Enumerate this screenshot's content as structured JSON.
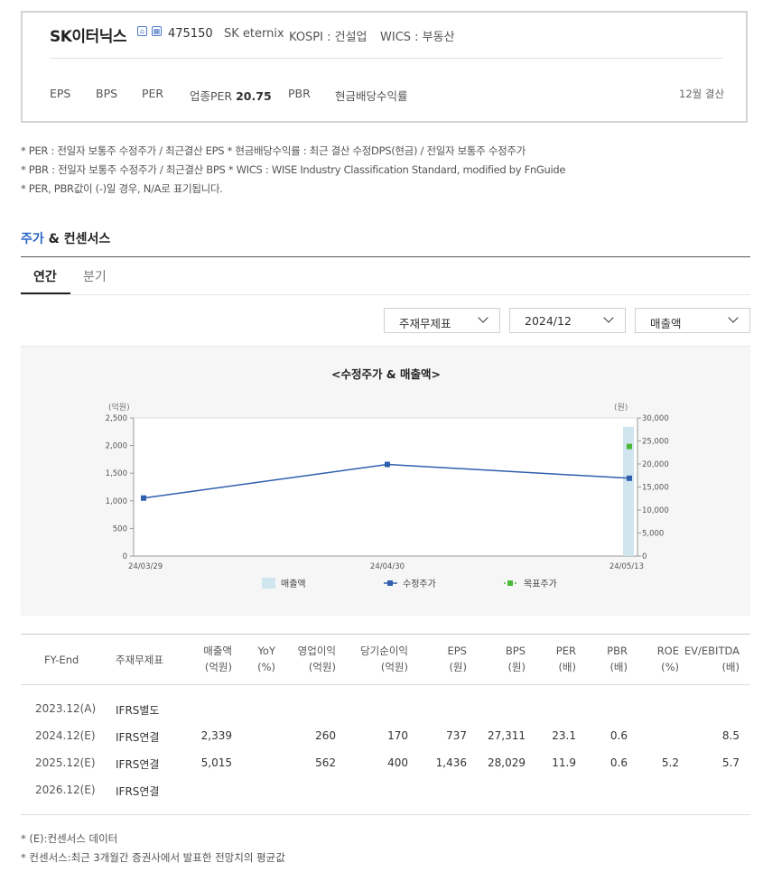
{
  "company": {
    "name": "SK이터닉스",
    "code": "475150",
    "english_name": "SK eternix",
    "market": "KOSPI : 건설업",
    "wics": "WICS : 부동산"
  },
  "metrics": {
    "eps": "EPS",
    "bps": "BPS",
    "per": "PER",
    "industry_per_label": "업종PER",
    "industry_per_value": "20.75",
    "pbr": "PBR",
    "dividend_yield": "현금배당수익률",
    "fiscal": "12월 결산"
  },
  "notes": [
    "* PER : 전일자 보통주 수정주가 / 최근결산 EPS * 현금배당수익률 : 최근 결산 수정DPS(현금) / 전일자 보통주 수정주가",
    "* PBR : 전일자 보통주 수정주가 / 최근결산 BPS * WICS : WISE Industry Classification Standard, modified by FnGuide",
    "* PER, PBR값이 (-)일 경우, N/A로 표기됩니다."
  ],
  "section": {
    "title_accent": "주가",
    "title_rest": " & 컨센서스",
    "tabs": [
      "연간",
      "분기"
    ]
  },
  "selects": {
    "statement": "주재무제표",
    "period": "2024/12",
    "item": "매출액"
  },
  "chart_data": {
    "type": "bar+line",
    "title": "<수정주가 & 매출액>",
    "left_axis_unit": "(억원)",
    "right_axis_unit": "(원)",
    "left_ticks": [
      "2,500",
      "2,000",
      "1,500",
      "1,000",
      "500",
      "0"
    ],
    "right_ticks": [
      "30,000",
      "25,000",
      "20,000",
      "15,000",
      "10,000",
      "5,000",
      "0"
    ],
    "ylim_left": [
      0,
      2500
    ],
    "ylim_right": [
      0,
      30000
    ],
    "x_labels": [
      "24/03/29",
      "24/04/30",
      "24/05/13"
    ],
    "series": [
      {
        "name": "매출액",
        "kind": "bar",
        "points": [
          {
            "x": "24/05/13",
            "y": 2339
          }
        ],
        "color": "#cfe6ef"
      },
      {
        "name": "수정주가",
        "kind": "line",
        "points": [
          {
            "x": "24/03/29",
            "y": 12600
          },
          {
            "x": "24/04/30",
            "y": 19900
          },
          {
            "x": "24/05/13",
            "y": 16900
          }
        ],
        "color": "#2f5fae"
      },
      {
        "name": "목표주가",
        "kind": "point",
        "points": [
          {
            "x": "24/05/13",
            "y": 23800
          }
        ],
        "color": "#4cb83a"
      }
    ],
    "legend_position": "bottom"
  },
  "table": {
    "headers": [
      [
        "FY-End"
      ],
      [
        "주재무제표"
      ],
      [
        "매출액",
        "(억원)"
      ],
      [
        "YoY",
        "(%)"
      ],
      [
        "영업이익",
        "(억원)"
      ],
      [
        "당기순이익",
        "(억원)"
      ],
      [
        "EPS",
        "(원)"
      ],
      [
        "BPS",
        "(원)"
      ],
      [
        "PER",
        "(배)"
      ],
      [
        "PBR",
        "(배)"
      ],
      [
        "ROE",
        "(%)"
      ],
      [
        "EV/EBITDA",
        "(배)"
      ]
    ],
    "rows": [
      [
        "2023.12(A)",
        "IFRS별도",
        "",
        "",
        "",
        "",
        "",
        "",
        "",
        "",
        "",
        ""
      ],
      [
        "2024.12(E)",
        "IFRS연결",
        "2,339",
        "",
        "260",
        "170",
        "737",
        "27,311",
        "23.1",
        "0.6",
        "",
        "8.5"
      ],
      [
        "2025.12(E)",
        "IFRS연결",
        "5,015",
        "",
        "562",
        "400",
        "1,436",
        "28,029",
        "11.9",
        "0.6",
        "5.2",
        "5.7"
      ],
      [
        "2026.12(E)",
        "IFRS연결",
        "",
        "",
        "",
        "",
        "",
        "",
        "",
        "",
        "",
        ""
      ]
    ]
  },
  "footnotes": [
    "* (E):컨센서스 데이터",
    "* 컨센서스:최근 3개월간 증권사에서 발표한 전망치의 평균값"
  ]
}
